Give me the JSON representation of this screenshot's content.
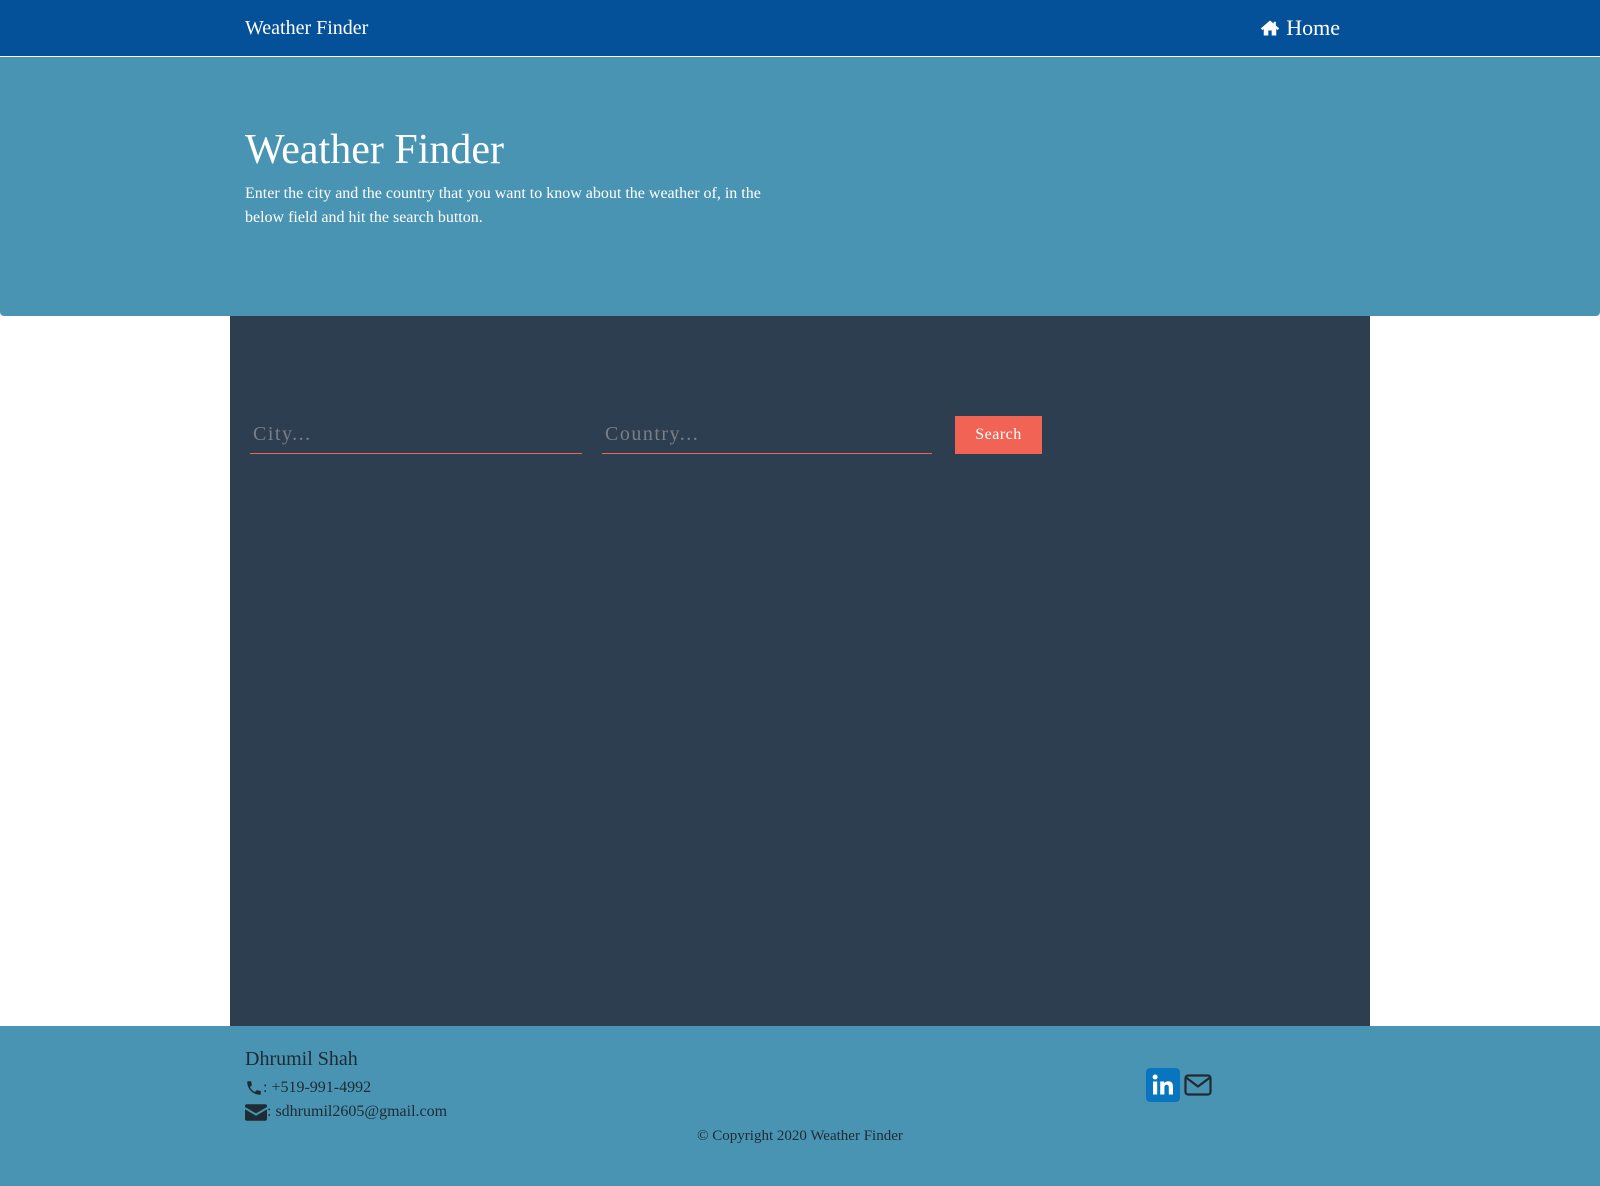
{
  "navbar": {
    "brand": "Weather Finder",
    "home_label": "Home",
    "home_icon": "home-icon"
  },
  "hero": {
    "title": "Weather Finder",
    "description": "Enter the city and the country that you want to know about the weather of, in the below field and hit the search button."
  },
  "search": {
    "city_placeholder": "City...",
    "city_value": "",
    "country_placeholder": "Country...",
    "country_value": "",
    "button_label": "Search"
  },
  "footer": {
    "name": "Dhrumil Shah",
    "phone": ": +519-991-4992",
    "phone_icon": "phone-icon",
    "email": ": sdhrumil2605@gmail.com",
    "email_icon": "envelope-icon",
    "social": [
      {
        "icon": "linkedin-icon"
      },
      {
        "icon": "mail-icon"
      }
    ],
    "copyright": "© Copyright 2020 Weather Finder"
  },
  "colors": {
    "navbar": "#04519a",
    "hero": "#4994b3",
    "panel": "#2d3e51",
    "accent": "#f16354",
    "linkedin": "#0a75bf"
  }
}
